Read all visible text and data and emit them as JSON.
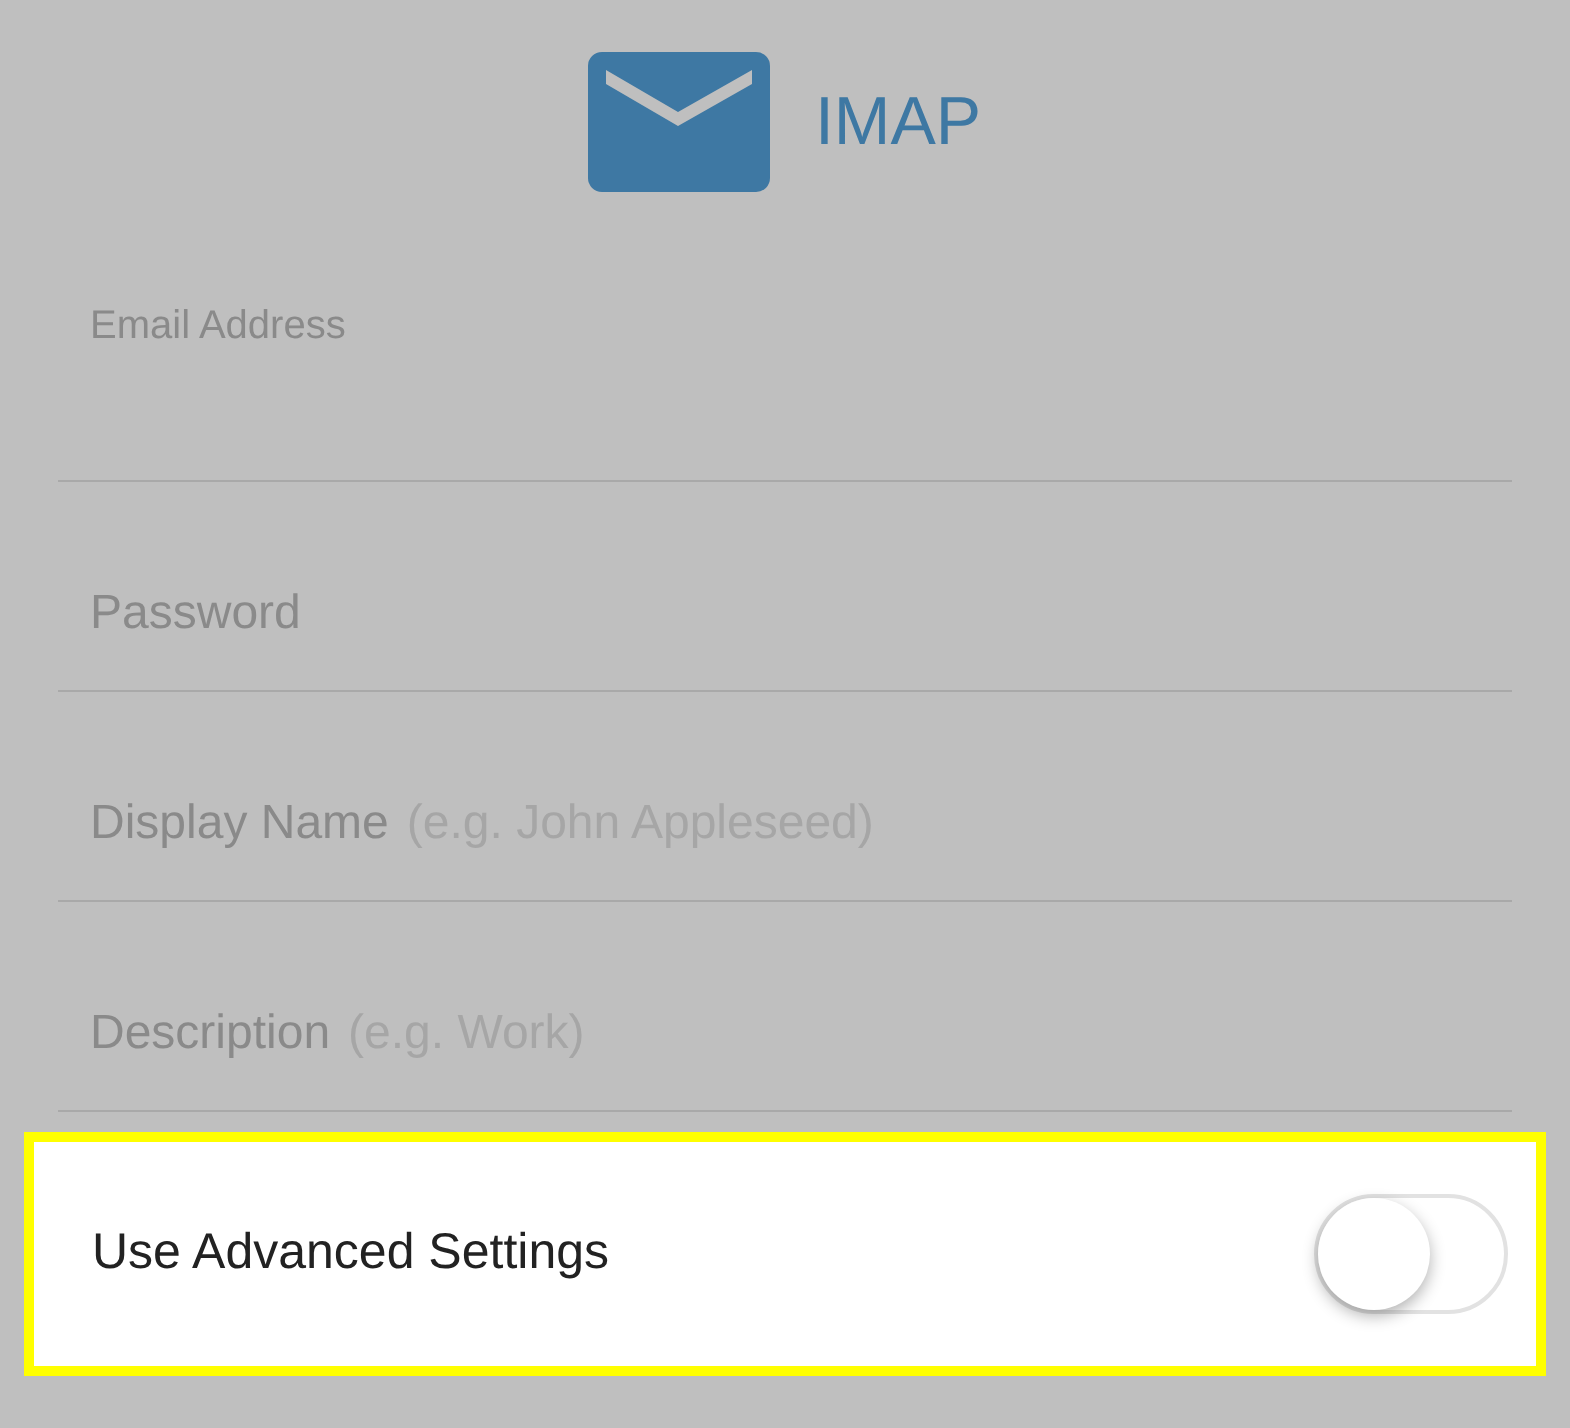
{
  "header": {
    "title": "IMAP"
  },
  "fields": [
    {
      "kind": "floating",
      "label": "Email Address"
    },
    {
      "kind": "inline",
      "label": "Password"
    },
    {
      "kind": "inline",
      "label": "Display Name",
      "hint": "(e.g. John Appleseed)"
    },
    {
      "kind": "inline",
      "label": "Description",
      "hint": "(e.g. Work)"
    }
  ],
  "advanced": {
    "label": "Use Advanced Settings",
    "on": false,
    "highlighted": true
  }
}
